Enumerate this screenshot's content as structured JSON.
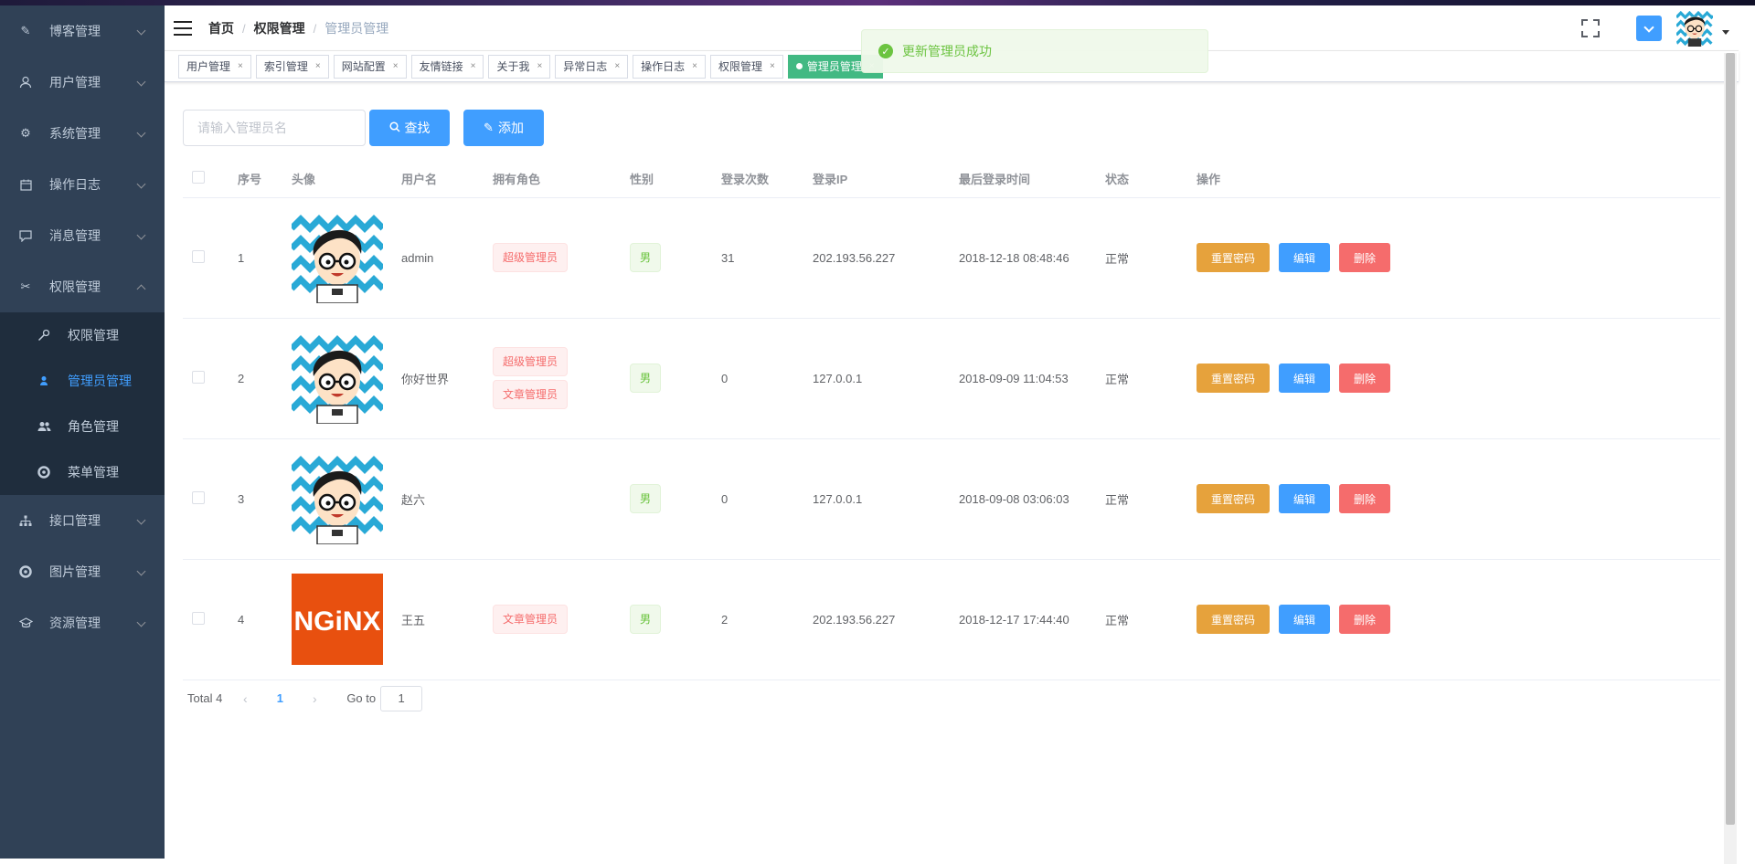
{
  "sidebar": {
    "items": [
      {
        "label": "博客管理",
        "icon": "edit-icon"
      },
      {
        "label": "用户管理",
        "icon": "user-icon"
      },
      {
        "label": "系统管理",
        "icon": "gear-icon"
      },
      {
        "label": "操作日志",
        "icon": "calendar-icon"
      },
      {
        "label": "消息管理",
        "icon": "message-icon"
      },
      {
        "label": "权限管理",
        "icon": "tools-icon",
        "expanded": true
      }
    ],
    "subitems": [
      {
        "label": "权限管理",
        "icon": "key-icon"
      },
      {
        "label": "管理员管理",
        "icon": "person-icon",
        "active": true
      },
      {
        "label": "角色管理",
        "icon": "group-icon"
      },
      {
        "label": "菜单管理",
        "icon": "ring-icon"
      }
    ],
    "bottom_items": [
      {
        "label": "接口管理",
        "icon": "network-icon"
      },
      {
        "label": "图片管理",
        "icon": "ring-icon"
      },
      {
        "label": "资源管理",
        "icon": "graduation-icon"
      }
    ]
  },
  "breadcrumb": [
    "首页",
    "权限管理",
    "管理员管理"
  ],
  "tags": [
    {
      "label": "用户管理"
    },
    {
      "label": "索引管理"
    },
    {
      "label": "网站配置"
    },
    {
      "label": "友情链接"
    },
    {
      "label": "关于我"
    },
    {
      "label": "异常日志"
    },
    {
      "label": "操作日志"
    },
    {
      "label": "权限管理"
    },
    {
      "label": "管理员管理",
      "active": true
    }
  ],
  "tag_close": "×",
  "toast": {
    "message": "更新管理员成功",
    "type": "success",
    "color": "#67c23a"
  },
  "search": {
    "placeholder": "请输入管理员名",
    "button": "查找"
  },
  "add_button": "添加",
  "table": {
    "headers": [
      "序号",
      "头像",
      "用户名",
      "拥有角色",
      "性别",
      "登录次数",
      "登录IP",
      "最后登录时间",
      "状态",
      "操作"
    ],
    "rows": [
      {
        "index": "1",
        "avatar": "cartoon-avatar",
        "username": "admin",
        "roles": [
          "超级管理员"
        ],
        "gender": "男",
        "logins": "31",
        "ip": "202.193.56.227",
        "last_login": "2018-12-18 08:48:46",
        "status": "正常"
      },
      {
        "index": "2",
        "avatar": "cartoon-avatar",
        "username": "你好世界",
        "roles": [
          "超级管理员",
          "文章管理员"
        ],
        "gender": "男",
        "logins": "0",
        "ip": "127.0.0.1",
        "last_login": "2018-09-09 11:04:53",
        "status": "正常"
      },
      {
        "index": "3",
        "avatar": "cartoon-avatar",
        "username": "赵六",
        "roles": [],
        "gender": "男",
        "logins": "0",
        "ip": "127.0.0.1",
        "last_login": "2018-09-08 03:06:03",
        "status": "正常"
      },
      {
        "index": "4",
        "avatar": "nginx-logo",
        "username": "王五",
        "roles": [
          "文章管理员"
        ],
        "gender": "男",
        "logins": "2",
        "ip": "202.193.56.227",
        "last_login": "2018-12-17 17:44:40",
        "status": "正常"
      }
    ],
    "actions": {
      "reset": "重置密码",
      "edit": "编辑",
      "delete": "删除"
    }
  },
  "pagination": {
    "total": "Total 4",
    "current": "1",
    "goto_label": "Go to",
    "goto_value": "1"
  },
  "logo_text": "NGiNX",
  "colors": {
    "sidebar": "#304156",
    "submenu": "#1f2d3d",
    "primary": "#409eff",
    "warning": "#e6a23c",
    "danger": "#f56c6c",
    "success": "#42b983"
  }
}
